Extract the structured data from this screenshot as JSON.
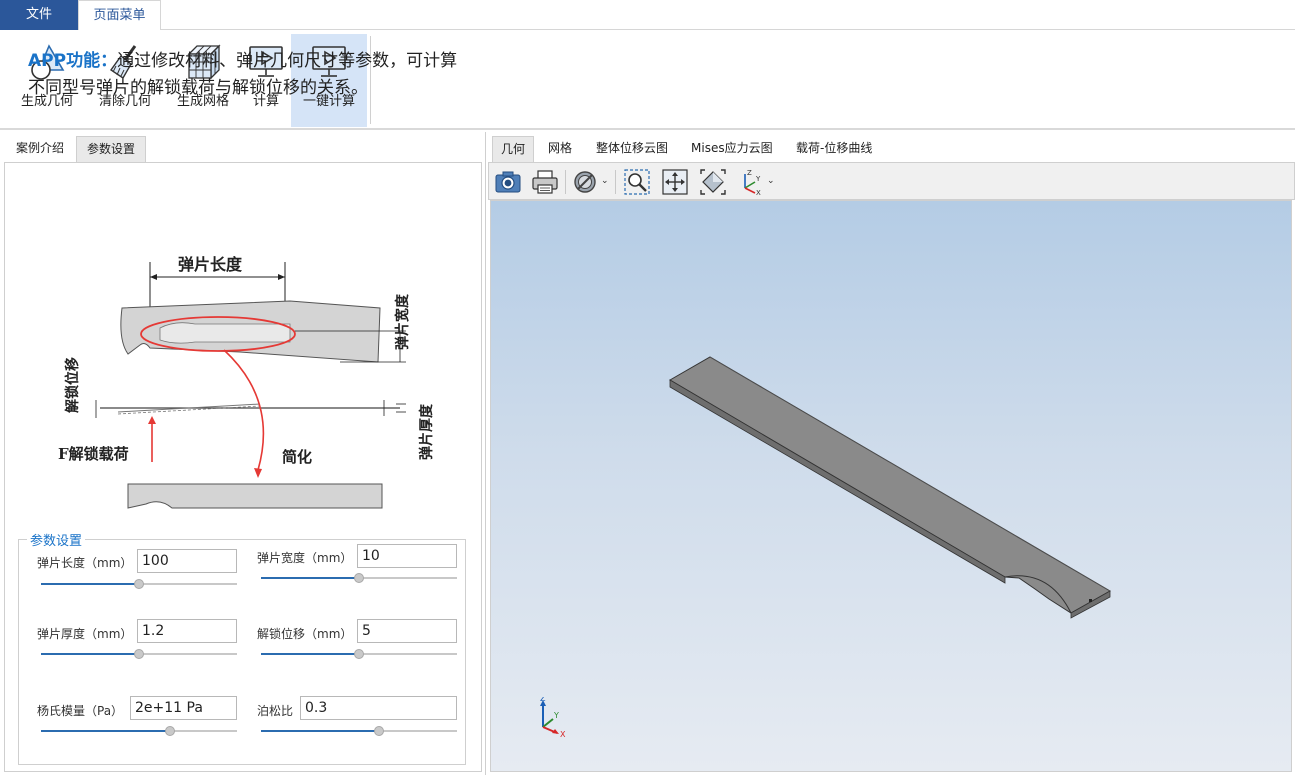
{
  "ribbon": {
    "tabs": [
      {
        "label": "文件"
      },
      {
        "label": "页面菜单"
      }
    ],
    "buttons": [
      {
        "label": "生成几何",
        "icon": "geometry-icon"
      },
      {
        "label": "清除几何",
        "icon": "broom-icon"
      },
      {
        "label": "生成网格",
        "icon": "mesh-cube-icon"
      },
      {
        "label": "计算",
        "icon": "monitor-play-icon"
      },
      {
        "label": "一键计算",
        "icon": "monitor-play-icon"
      }
    ]
  },
  "left": {
    "tabs": [
      {
        "label": "案例介绍"
      },
      {
        "label": "参数设置"
      }
    ],
    "description": {
      "highlight": "APP功能：",
      "text": "通过修改材料、弹片几何尺寸等参数，可计算不同型号弹片的解锁载荷与解锁位移的关系。"
    },
    "diagram": {
      "length_label": "弹片长度",
      "width_label": "弹片宽度",
      "disp_label": "解锁位移",
      "thickness_label": "弹片厚度",
      "load_label": "F解锁载荷",
      "simplify_label": "简化"
    },
    "params": {
      "title": "参数设置",
      "length": {
        "label": "弹片长度（mm）",
        "value": "100",
        "slider": 0.5
      },
      "width": {
        "label": "弹片宽度（mm）",
        "value": "10",
        "slider": 0.5
      },
      "thickness": {
        "label": "弹片厚度（mm）",
        "value": "1.2",
        "slider": 0.5
      },
      "unlock_disp": {
        "label": "解锁位移（mm）",
        "value": "5",
        "slider": 0.5
      },
      "youngs": {
        "label": "杨氏模量（Pa）",
        "value": "2e+11 Pa",
        "slider": 0.66
      },
      "poisson": {
        "label": "泊松比",
        "value": "0.3",
        "slider": 0.6
      }
    }
  },
  "right": {
    "tabs": [
      {
        "label": "几何"
      },
      {
        "label": "网格"
      },
      {
        "label": "整体位移云图"
      },
      {
        "label": "Mises应力云图"
      },
      {
        "label": "载荷-位移曲线"
      }
    ],
    "toolbar": [
      {
        "icon": "camera-icon"
      },
      {
        "icon": "print-icon"
      },
      {
        "icon": "hide-icon"
      },
      {
        "icon": "zoom-box-icon"
      },
      {
        "icon": "fit-view-icon"
      },
      {
        "icon": "zoom-extents-icon"
      },
      {
        "icon": "axis-orientation-icon"
      }
    ],
    "triad": {
      "x": "X",
      "y": "Y",
      "z": "Z"
    }
  },
  "colors": {
    "file_tab": "#2b579a",
    "accent": "#1a73c8",
    "active_button": "#d5e4f7"
  }
}
